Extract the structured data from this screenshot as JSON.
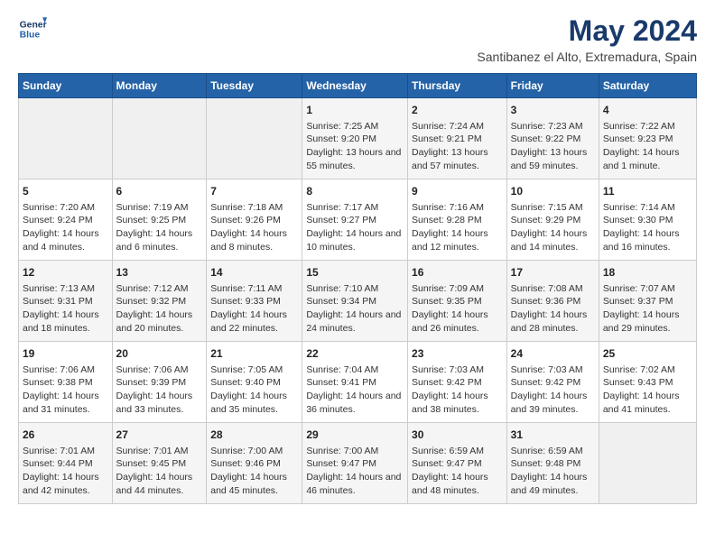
{
  "logo": {
    "line1": "General",
    "line2": "Blue"
  },
  "title": "May 2024",
  "subtitle": "Santibanez el Alto, Extremadura, Spain",
  "days_of_week": [
    "Sunday",
    "Monday",
    "Tuesday",
    "Wednesday",
    "Thursday",
    "Friday",
    "Saturday"
  ],
  "weeks": [
    [
      {
        "day": "",
        "info": ""
      },
      {
        "day": "",
        "info": ""
      },
      {
        "day": "",
        "info": ""
      },
      {
        "day": "1",
        "info": "Sunrise: 7:25 AM\nSunset: 9:20 PM\nDaylight: 13 hours and 55 minutes."
      },
      {
        "day": "2",
        "info": "Sunrise: 7:24 AM\nSunset: 9:21 PM\nDaylight: 13 hours and 57 minutes."
      },
      {
        "day": "3",
        "info": "Sunrise: 7:23 AM\nSunset: 9:22 PM\nDaylight: 13 hours and 59 minutes."
      },
      {
        "day": "4",
        "info": "Sunrise: 7:22 AM\nSunset: 9:23 PM\nDaylight: 14 hours and 1 minute."
      }
    ],
    [
      {
        "day": "5",
        "info": "Sunrise: 7:20 AM\nSunset: 9:24 PM\nDaylight: 14 hours and 4 minutes."
      },
      {
        "day": "6",
        "info": "Sunrise: 7:19 AM\nSunset: 9:25 PM\nDaylight: 14 hours and 6 minutes."
      },
      {
        "day": "7",
        "info": "Sunrise: 7:18 AM\nSunset: 9:26 PM\nDaylight: 14 hours and 8 minutes."
      },
      {
        "day": "8",
        "info": "Sunrise: 7:17 AM\nSunset: 9:27 PM\nDaylight: 14 hours and 10 minutes."
      },
      {
        "day": "9",
        "info": "Sunrise: 7:16 AM\nSunset: 9:28 PM\nDaylight: 14 hours and 12 minutes."
      },
      {
        "day": "10",
        "info": "Sunrise: 7:15 AM\nSunset: 9:29 PM\nDaylight: 14 hours and 14 minutes."
      },
      {
        "day": "11",
        "info": "Sunrise: 7:14 AM\nSunset: 9:30 PM\nDaylight: 14 hours and 16 minutes."
      }
    ],
    [
      {
        "day": "12",
        "info": "Sunrise: 7:13 AM\nSunset: 9:31 PM\nDaylight: 14 hours and 18 minutes."
      },
      {
        "day": "13",
        "info": "Sunrise: 7:12 AM\nSunset: 9:32 PM\nDaylight: 14 hours and 20 minutes."
      },
      {
        "day": "14",
        "info": "Sunrise: 7:11 AM\nSunset: 9:33 PM\nDaylight: 14 hours and 22 minutes."
      },
      {
        "day": "15",
        "info": "Sunrise: 7:10 AM\nSunset: 9:34 PM\nDaylight: 14 hours and 24 minutes."
      },
      {
        "day": "16",
        "info": "Sunrise: 7:09 AM\nSunset: 9:35 PM\nDaylight: 14 hours and 26 minutes."
      },
      {
        "day": "17",
        "info": "Sunrise: 7:08 AM\nSunset: 9:36 PM\nDaylight: 14 hours and 28 minutes."
      },
      {
        "day": "18",
        "info": "Sunrise: 7:07 AM\nSunset: 9:37 PM\nDaylight: 14 hours and 29 minutes."
      }
    ],
    [
      {
        "day": "19",
        "info": "Sunrise: 7:06 AM\nSunset: 9:38 PM\nDaylight: 14 hours and 31 minutes."
      },
      {
        "day": "20",
        "info": "Sunrise: 7:06 AM\nSunset: 9:39 PM\nDaylight: 14 hours and 33 minutes."
      },
      {
        "day": "21",
        "info": "Sunrise: 7:05 AM\nSunset: 9:40 PM\nDaylight: 14 hours and 35 minutes."
      },
      {
        "day": "22",
        "info": "Sunrise: 7:04 AM\nSunset: 9:41 PM\nDaylight: 14 hours and 36 minutes."
      },
      {
        "day": "23",
        "info": "Sunrise: 7:03 AM\nSunset: 9:42 PM\nDaylight: 14 hours and 38 minutes."
      },
      {
        "day": "24",
        "info": "Sunrise: 7:03 AM\nSunset: 9:42 PM\nDaylight: 14 hours and 39 minutes."
      },
      {
        "day": "25",
        "info": "Sunrise: 7:02 AM\nSunset: 9:43 PM\nDaylight: 14 hours and 41 minutes."
      }
    ],
    [
      {
        "day": "26",
        "info": "Sunrise: 7:01 AM\nSunset: 9:44 PM\nDaylight: 14 hours and 42 minutes."
      },
      {
        "day": "27",
        "info": "Sunrise: 7:01 AM\nSunset: 9:45 PM\nDaylight: 14 hours and 44 minutes."
      },
      {
        "day": "28",
        "info": "Sunrise: 7:00 AM\nSunset: 9:46 PM\nDaylight: 14 hours and 45 minutes."
      },
      {
        "day": "29",
        "info": "Sunrise: 7:00 AM\nSunset: 9:47 PM\nDaylight: 14 hours and 46 minutes."
      },
      {
        "day": "30",
        "info": "Sunrise: 6:59 AM\nSunset: 9:47 PM\nDaylight: 14 hours and 48 minutes."
      },
      {
        "day": "31",
        "info": "Sunrise: 6:59 AM\nSunset: 9:48 PM\nDaylight: 14 hours and 49 minutes."
      },
      {
        "day": "",
        "info": ""
      }
    ]
  ]
}
